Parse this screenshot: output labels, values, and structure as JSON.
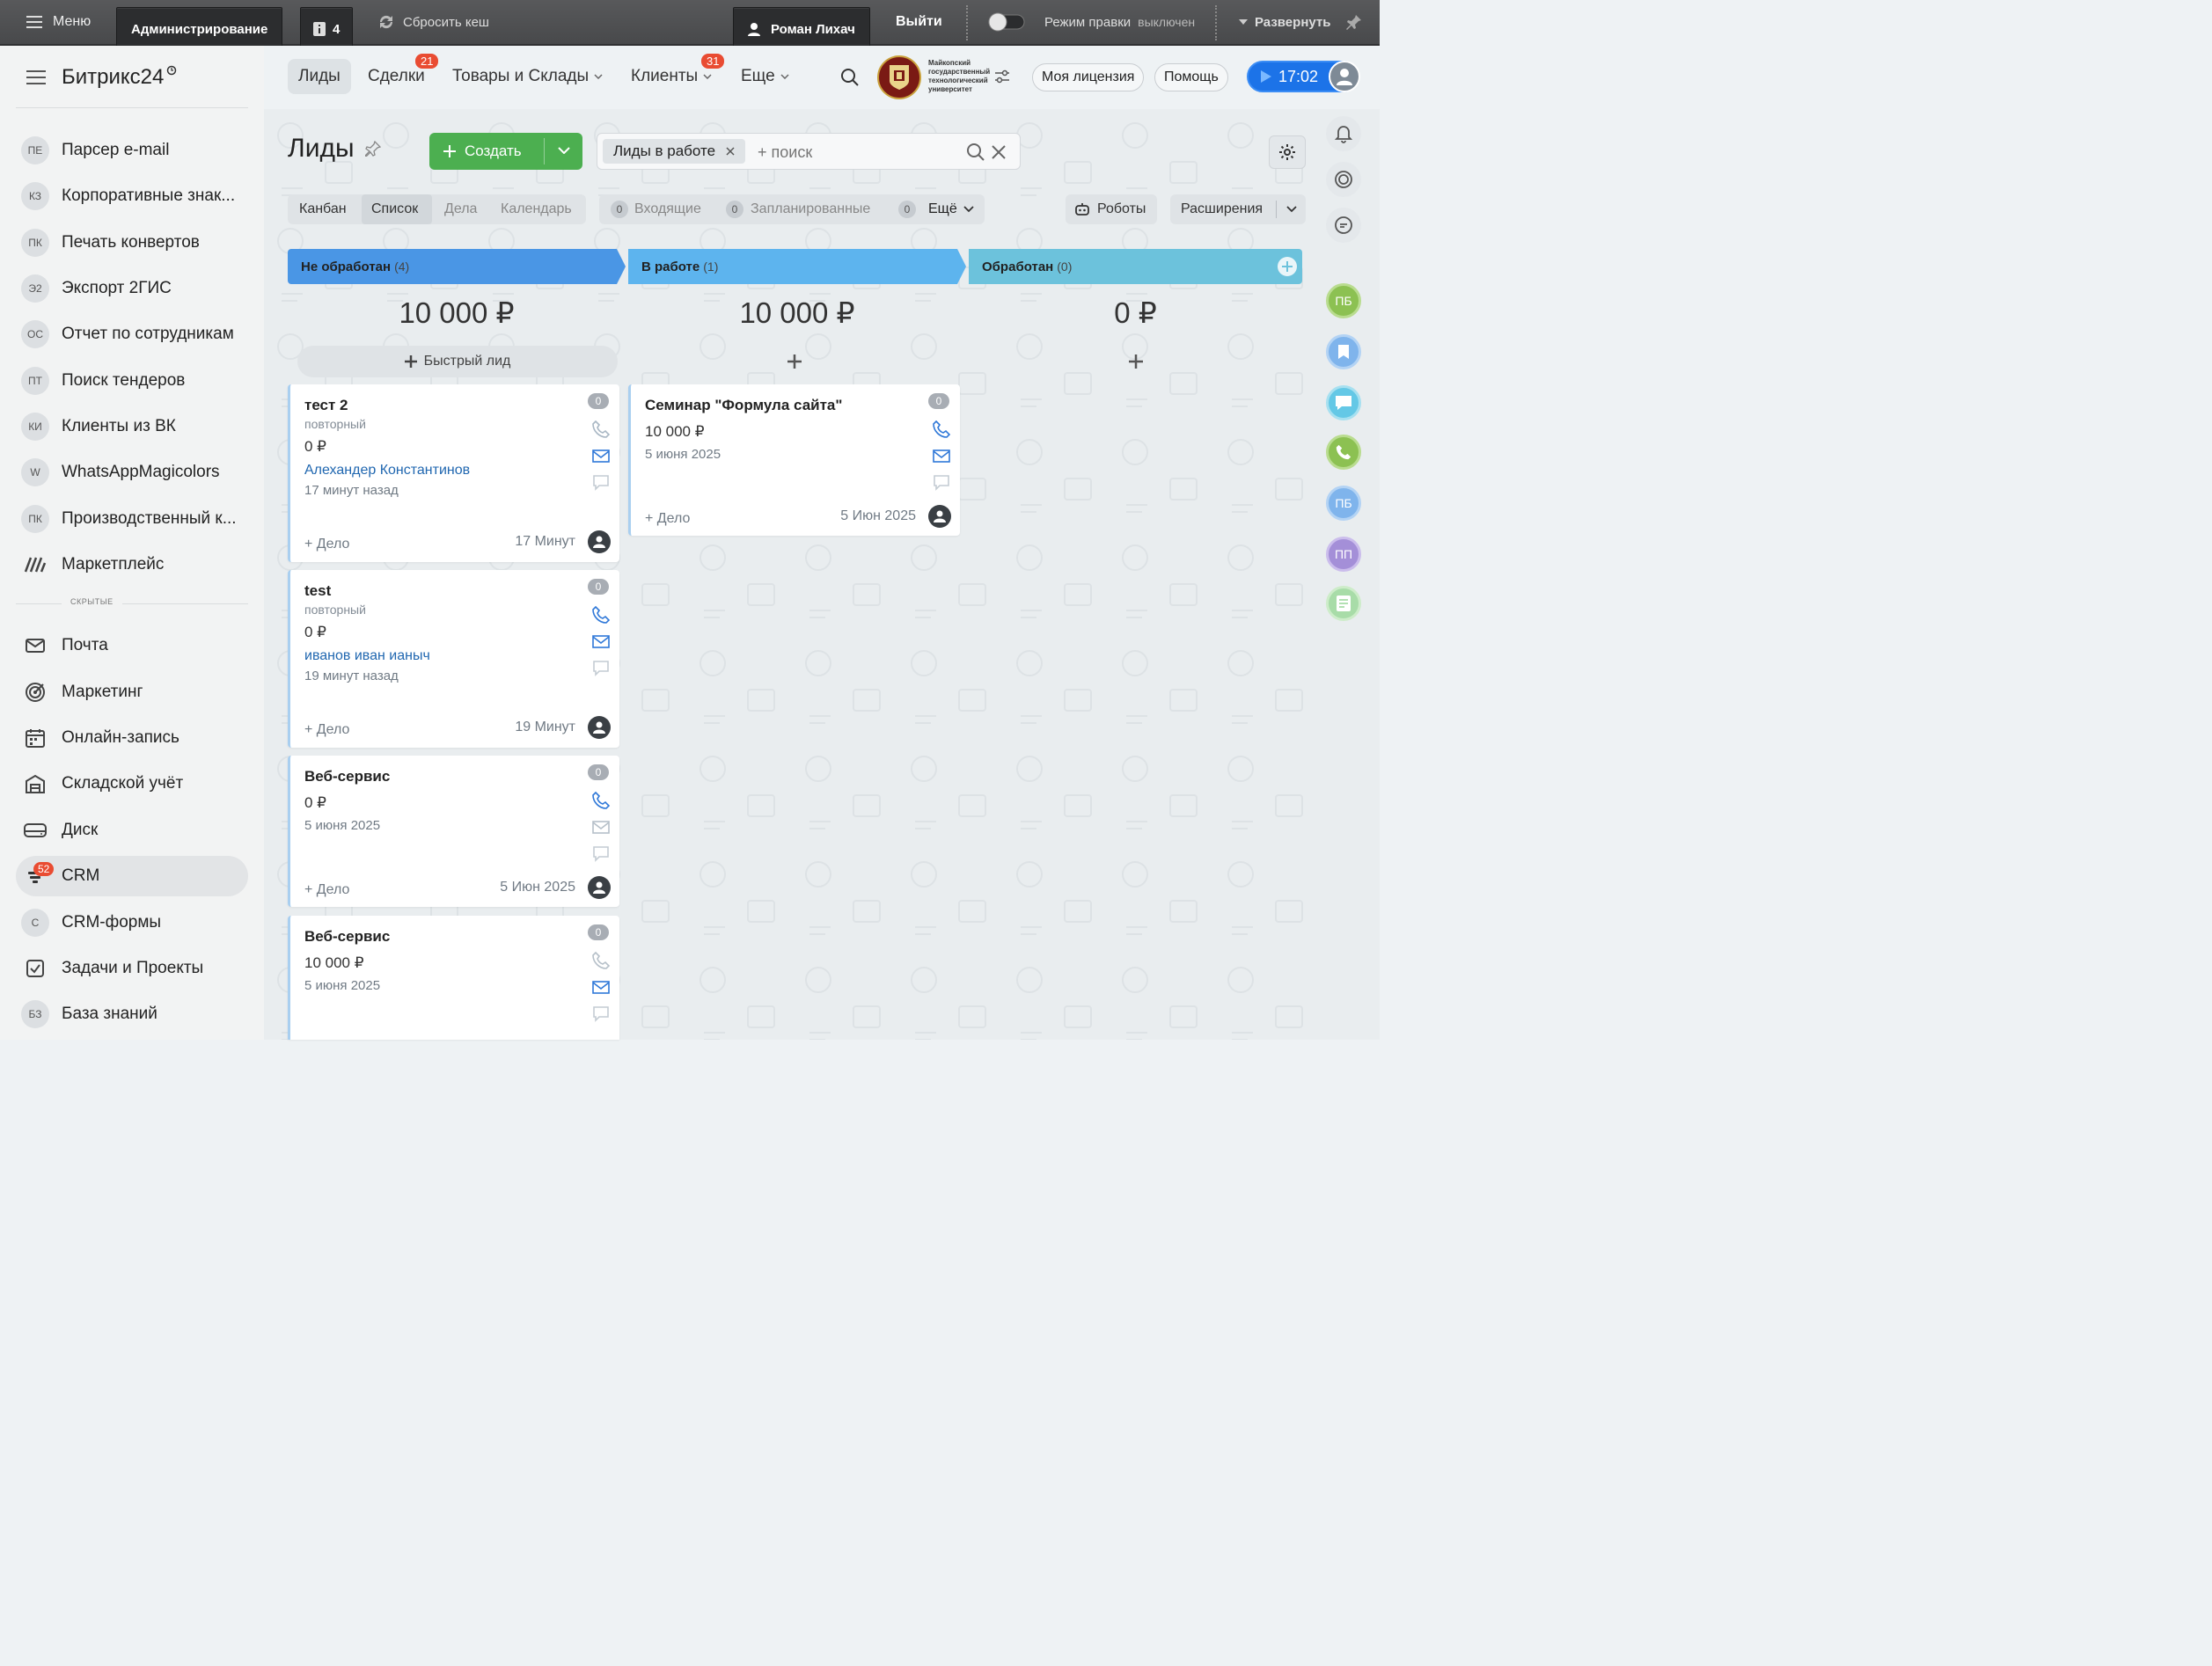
{
  "admin_bar": {
    "menu": "Меню",
    "admin": "Администрирование",
    "count": "4",
    "clear_cache": "Сбросить кеш",
    "user": "Роман Лихач",
    "logout": "Выйти",
    "edit_mode_label": "Режим правки",
    "edit_mode_state": "выключен",
    "expand": "Развернуть"
  },
  "sidebar": {
    "logo": "Битрикс24",
    "items": [
      {
        "abbr": "ПЕ",
        "label": "Парсер e-mail"
      },
      {
        "abbr": "КЗ",
        "label": "Корпоративные знак..."
      },
      {
        "abbr": "ПК",
        "label": "Печать конвертов"
      },
      {
        "abbr": "Э2",
        "label": "Экспорт 2ГИС"
      },
      {
        "abbr": "ОС",
        "label": "Отчет по сотрудникам"
      },
      {
        "abbr": "ПТ",
        "label": "Поиск тендеров"
      },
      {
        "abbr": "КИ",
        "label": "Клиенты из ВК"
      },
      {
        "abbr": "W",
        "label": "WhatsAppMagicolors"
      },
      {
        "abbr": "ПК",
        "label": "Производственный к..."
      },
      {
        "icon": "marketplace-icon",
        "label": "Маркетплейс"
      }
    ],
    "hidden_label": "СКРЫТЫЕ",
    "hidden_items": [
      {
        "icon": "mail-icon",
        "label": "Почта"
      },
      {
        "icon": "marketing-icon",
        "label": "Маркетинг"
      },
      {
        "icon": "calendar-icon",
        "label": "Онлайн-запись"
      },
      {
        "icon": "warehouse-icon",
        "label": "Складской учёт"
      },
      {
        "icon": "disk-icon",
        "label": "Диск"
      },
      {
        "icon": "crm-icon",
        "label": "CRM",
        "badge": "52"
      },
      {
        "abbr": "С",
        "label": "CRM-формы"
      },
      {
        "icon": "task-icon",
        "label": "Задачи и Проекты"
      },
      {
        "abbr": "БЗ",
        "label": "База знаний"
      }
    ]
  },
  "header": {
    "tabs": [
      {
        "label": "Лиды"
      },
      {
        "label": "Сделки",
        "badge": "21"
      },
      {
        "label": "Товары и Склады"
      },
      {
        "label": "Клиенты",
        "badge": "31"
      },
      {
        "label": "Еще"
      }
    ],
    "org_name": "Майкопский государственный технологический университет",
    "license": "Моя лицензия",
    "help": "Помощь",
    "time": "17:02"
  },
  "page": {
    "title": "Лиды",
    "create": "Создать",
    "filter_tag": "Лиды в работе",
    "search_placeholder": "+ поиск",
    "views": [
      "Канбан",
      "Список",
      "Дела",
      "Календарь"
    ],
    "counters": [
      {
        "n": "0",
        "label": "Входящие"
      },
      {
        "n": "0",
        "label": "Запланированные"
      },
      {
        "n": "0",
        "label": "Ещё"
      }
    ],
    "robots": "Роботы",
    "extensions": "Расширения",
    "quick_lead": "Быстрый лид"
  },
  "colors": {
    "stage1": "#4a96e5",
    "stage2": "#5db4ee",
    "stage3": "#6cc2dc",
    "accent": "#3bc8f5",
    "create": "#4caf50"
  },
  "columns": [
    {
      "name": "Не обработан",
      "count": "(4)",
      "sum": "10 000 ₽"
    },
    {
      "name": "В работе",
      "count": "(1)",
      "sum": "10 000 ₽"
    },
    {
      "name": "Обработан",
      "count": "(0)",
      "sum": "0 ₽"
    }
  ],
  "cards": [
    {
      "title": "тест 2",
      "badge": "0",
      "sub": "повторный",
      "amount": "0 ₽",
      "contact": "Алехандер Константинов",
      "ago": "17 минут назад",
      "deal": "+ Дело",
      "time": "17 Минут"
    },
    {
      "title": "test",
      "badge": "0",
      "sub": "повторный",
      "amount": "0 ₽",
      "contact": "иванов иван ианыч",
      "ago": "19 минут назад",
      "deal": "+ Дело",
      "time": "19 Минут"
    },
    {
      "title": "Веб-сервис",
      "badge": "0",
      "amount": "0 ₽",
      "date": "5 июня 2025",
      "deal": "+ Дело",
      "time": "5 Июн 2025"
    },
    {
      "title": "Веб-сервис",
      "badge": "0",
      "amount": "10 000 ₽",
      "date": "5 июня 2025"
    },
    {
      "title": "Семинар \"Формула сайта\"",
      "badge": "0",
      "amount": "10 000 ₽",
      "date": "5 июня 2025",
      "deal": "+ Дело",
      "time": "5 Июн 2025"
    }
  ],
  "right_bar": [
    "ПБ",
    "ПБ",
    "ПП"
  ]
}
